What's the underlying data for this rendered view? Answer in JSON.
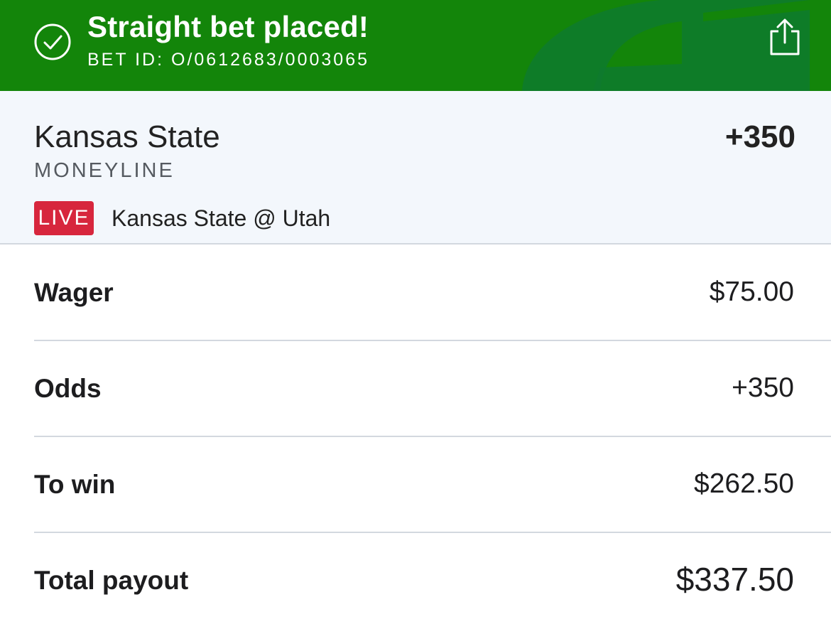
{
  "header": {
    "title": "Straight bet placed!",
    "bet_id": "BET ID: O/0612683/0003065",
    "icons": {
      "status": "check-circle-icon",
      "share": "share-icon"
    },
    "colors": {
      "background": "#13850a",
      "accent_shape": "#0e7a2e"
    }
  },
  "selection": {
    "team": "Kansas State",
    "odds": "+350",
    "market": "MONEYLINE",
    "live_label": "LIVE",
    "event": "Kansas State @ Utah",
    "colors": {
      "background": "#f3f7fc",
      "live_badge": "#d7263d"
    }
  },
  "summary": {
    "rows": [
      {
        "label": "Wager",
        "value": "$75.00"
      },
      {
        "label": "Odds",
        "value": "+350"
      },
      {
        "label": "To win",
        "value": "$262.50"
      },
      {
        "label": "Total payout",
        "value": "$337.50"
      }
    ]
  }
}
